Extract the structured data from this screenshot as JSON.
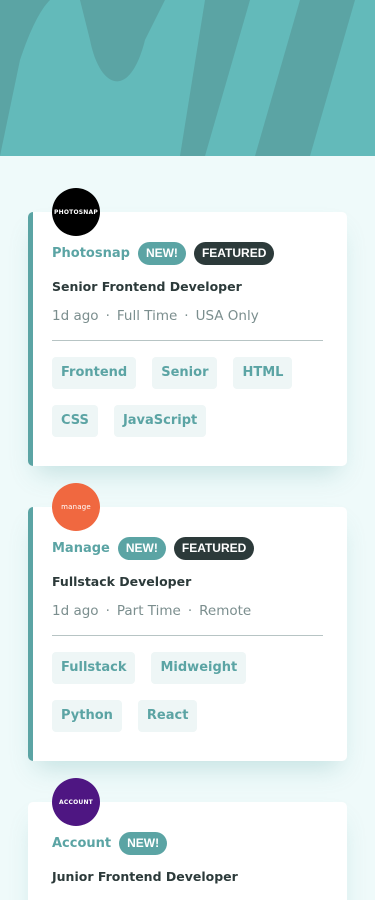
{
  "colors": {
    "primary": "#5ba4a4",
    "dark": "#2c3a3a",
    "background": "#effafa",
    "tag_bg": "#eef6f6"
  },
  "jobs": [
    {
      "logo_text": "PHOTOSNAP",
      "logo_color": "#000000",
      "company": "Photosnap",
      "new_label": "NEW!",
      "featured_label": "FEATURED",
      "position": "Senior Frontend Developer",
      "posted": "1d ago",
      "contract": "Full Time",
      "location": "USA Only",
      "tags": [
        "Frontend",
        "Senior",
        "HTML",
        "CSS",
        "JavaScript"
      ]
    },
    {
      "logo_text": "manage",
      "logo_color": "#f06840",
      "company": "Manage",
      "new_label": "NEW!",
      "featured_label": "FEATURED",
      "position": "Fullstack Developer",
      "posted": "1d ago",
      "contract": "Part Time",
      "location": "Remote",
      "tags": [
        "Fullstack",
        "Midweight",
        "Python",
        "React"
      ]
    },
    {
      "logo_text": "ACCOUNT",
      "logo_color": "#4e1682",
      "company": "Account",
      "new_label": "NEW!",
      "position": "Junior Frontend Developer"
    }
  ],
  "separator": "·"
}
